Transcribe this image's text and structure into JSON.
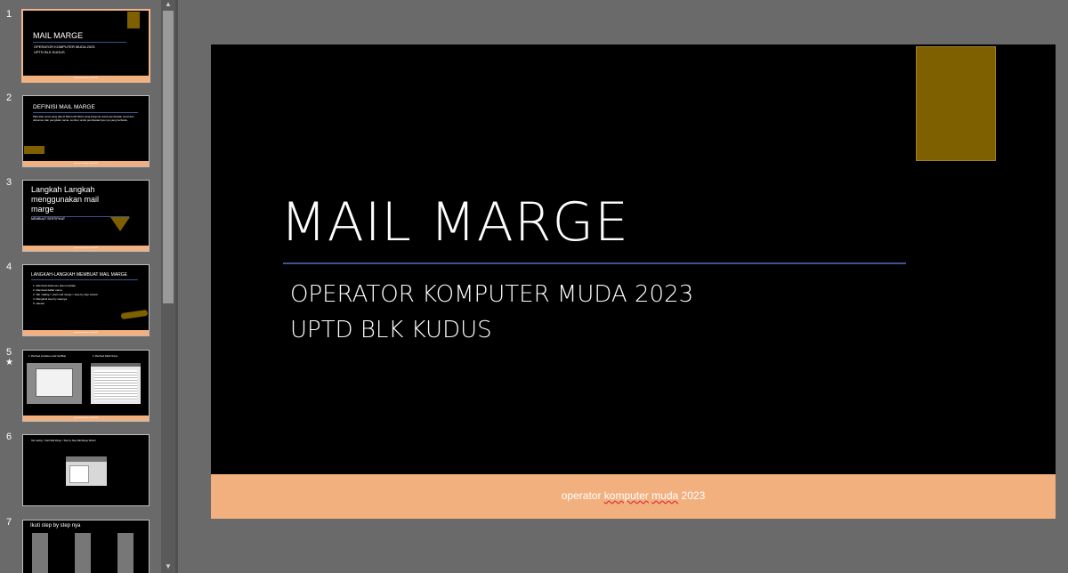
{
  "slides": [
    {
      "number": "1",
      "title": "MAIL MARGE",
      "lines": [
        "OPERATOR KOMPUTER MUDA 2023",
        "UPTD BLK KUDUS"
      ]
    },
    {
      "number": "2",
      "title": "DEFINISI MAIL MARGE",
      "body": "Mail atau surat yang ada di Microsoft Word yang berguna untuk pembuatan surat dan dokumen dan pengisian nama, sumber untuk pembuatannya nya yang berbeda."
    },
    {
      "number": "3",
      "title": "Langkah Langkah menggunakan mail marge",
      "subtitle": "MEMBUAT SERTIFIKAT"
    },
    {
      "number": "4",
      "title": "LANGKAH-LANGKAH MEMBUAT MAIL MARGE",
      "items": [
        "1. Membuat dokumen atau template",
        "2. Membuat daftar nama",
        "3. Tab mailing > start mail merge > step by step wizard",
        "4. Mengikuti step by stepnya",
        "5. selesai"
      ]
    },
    {
      "number": "5",
      "marker": "★",
      "left_caption": "1. Membuat templates untuk Sertifikat",
      "right_caption": "2. Membuat Daftar Nama"
    },
    {
      "number": "6",
      "caption": "Tab mailing > Start Mail Merge > Step by Step Mail Merge Wizard"
    },
    {
      "number": "7",
      "title": "Ikuti step by step nya"
    }
  ],
  "main_slide": {
    "title": "MAIL MARGE",
    "subtitle1": "OPERATOR KOMPUTER MUDA 2023",
    "subtitle2": "UPTD BLK KUDUS",
    "footer_word1": "operator",
    "footer_word2": "komputer",
    "footer_word3": "muda",
    "footer_word4": "2023"
  },
  "thumb_footer": "operator komputer muda 2023",
  "colors": {
    "accent": "#7f6000",
    "footer": "#f2b07f",
    "title_line": "#3b5590",
    "selected_border": "#f0b48c"
  },
  "scroll_icons": {
    "up": "scroll-up-arrow",
    "down": "scroll-down-arrow"
  }
}
